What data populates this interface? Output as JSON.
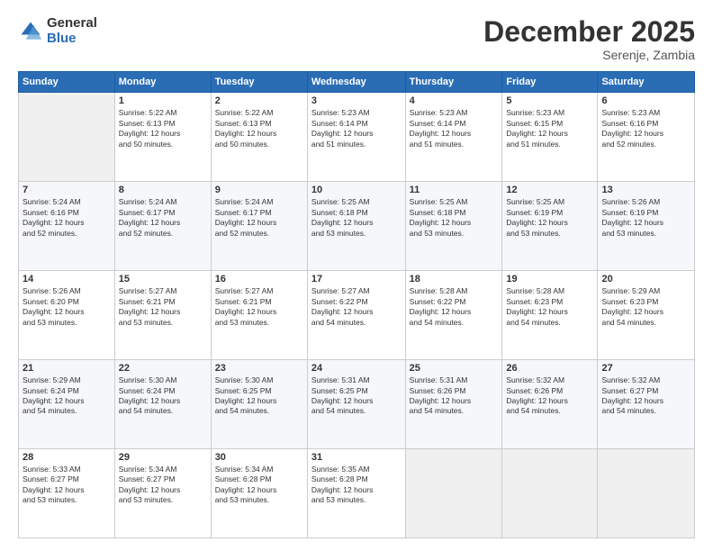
{
  "logo": {
    "general": "General",
    "blue": "Blue"
  },
  "header": {
    "month": "December 2025",
    "location": "Serenje, Zambia"
  },
  "weekdays": [
    "Sunday",
    "Monday",
    "Tuesday",
    "Wednesday",
    "Thursday",
    "Friday",
    "Saturday"
  ],
  "weeks": [
    [
      {
        "day": "",
        "info": ""
      },
      {
        "day": "1",
        "info": "Sunrise: 5:22 AM\nSunset: 6:13 PM\nDaylight: 12 hours\nand 50 minutes."
      },
      {
        "day": "2",
        "info": "Sunrise: 5:22 AM\nSunset: 6:13 PM\nDaylight: 12 hours\nand 50 minutes."
      },
      {
        "day": "3",
        "info": "Sunrise: 5:23 AM\nSunset: 6:14 PM\nDaylight: 12 hours\nand 51 minutes."
      },
      {
        "day": "4",
        "info": "Sunrise: 5:23 AM\nSunset: 6:14 PM\nDaylight: 12 hours\nand 51 minutes."
      },
      {
        "day": "5",
        "info": "Sunrise: 5:23 AM\nSunset: 6:15 PM\nDaylight: 12 hours\nand 51 minutes."
      },
      {
        "day": "6",
        "info": "Sunrise: 5:23 AM\nSunset: 6:16 PM\nDaylight: 12 hours\nand 52 minutes."
      }
    ],
    [
      {
        "day": "7",
        "info": "Sunrise: 5:24 AM\nSunset: 6:16 PM\nDaylight: 12 hours\nand 52 minutes."
      },
      {
        "day": "8",
        "info": "Sunrise: 5:24 AM\nSunset: 6:17 PM\nDaylight: 12 hours\nand 52 minutes."
      },
      {
        "day": "9",
        "info": "Sunrise: 5:24 AM\nSunset: 6:17 PM\nDaylight: 12 hours\nand 52 minutes."
      },
      {
        "day": "10",
        "info": "Sunrise: 5:25 AM\nSunset: 6:18 PM\nDaylight: 12 hours\nand 53 minutes."
      },
      {
        "day": "11",
        "info": "Sunrise: 5:25 AM\nSunset: 6:18 PM\nDaylight: 12 hours\nand 53 minutes."
      },
      {
        "day": "12",
        "info": "Sunrise: 5:25 AM\nSunset: 6:19 PM\nDaylight: 12 hours\nand 53 minutes."
      },
      {
        "day": "13",
        "info": "Sunrise: 5:26 AM\nSunset: 6:19 PM\nDaylight: 12 hours\nand 53 minutes."
      }
    ],
    [
      {
        "day": "14",
        "info": "Sunrise: 5:26 AM\nSunset: 6:20 PM\nDaylight: 12 hours\nand 53 minutes."
      },
      {
        "day": "15",
        "info": "Sunrise: 5:27 AM\nSunset: 6:21 PM\nDaylight: 12 hours\nand 53 minutes."
      },
      {
        "day": "16",
        "info": "Sunrise: 5:27 AM\nSunset: 6:21 PM\nDaylight: 12 hours\nand 53 minutes."
      },
      {
        "day": "17",
        "info": "Sunrise: 5:27 AM\nSunset: 6:22 PM\nDaylight: 12 hours\nand 54 minutes."
      },
      {
        "day": "18",
        "info": "Sunrise: 5:28 AM\nSunset: 6:22 PM\nDaylight: 12 hours\nand 54 minutes."
      },
      {
        "day": "19",
        "info": "Sunrise: 5:28 AM\nSunset: 6:23 PM\nDaylight: 12 hours\nand 54 minutes."
      },
      {
        "day": "20",
        "info": "Sunrise: 5:29 AM\nSunset: 6:23 PM\nDaylight: 12 hours\nand 54 minutes."
      }
    ],
    [
      {
        "day": "21",
        "info": "Sunrise: 5:29 AM\nSunset: 6:24 PM\nDaylight: 12 hours\nand 54 minutes."
      },
      {
        "day": "22",
        "info": "Sunrise: 5:30 AM\nSunset: 6:24 PM\nDaylight: 12 hours\nand 54 minutes."
      },
      {
        "day": "23",
        "info": "Sunrise: 5:30 AM\nSunset: 6:25 PM\nDaylight: 12 hours\nand 54 minutes."
      },
      {
        "day": "24",
        "info": "Sunrise: 5:31 AM\nSunset: 6:25 PM\nDaylight: 12 hours\nand 54 minutes."
      },
      {
        "day": "25",
        "info": "Sunrise: 5:31 AM\nSunset: 6:26 PM\nDaylight: 12 hours\nand 54 minutes."
      },
      {
        "day": "26",
        "info": "Sunrise: 5:32 AM\nSunset: 6:26 PM\nDaylight: 12 hours\nand 54 minutes."
      },
      {
        "day": "27",
        "info": "Sunrise: 5:32 AM\nSunset: 6:27 PM\nDaylight: 12 hours\nand 54 minutes."
      }
    ],
    [
      {
        "day": "28",
        "info": "Sunrise: 5:33 AM\nSunset: 6:27 PM\nDaylight: 12 hours\nand 53 minutes."
      },
      {
        "day": "29",
        "info": "Sunrise: 5:34 AM\nSunset: 6:27 PM\nDaylight: 12 hours\nand 53 minutes."
      },
      {
        "day": "30",
        "info": "Sunrise: 5:34 AM\nSunset: 6:28 PM\nDaylight: 12 hours\nand 53 minutes."
      },
      {
        "day": "31",
        "info": "Sunrise: 5:35 AM\nSunset: 6:28 PM\nDaylight: 12 hours\nand 53 minutes."
      },
      {
        "day": "",
        "info": ""
      },
      {
        "day": "",
        "info": ""
      },
      {
        "day": "",
        "info": ""
      }
    ]
  ]
}
